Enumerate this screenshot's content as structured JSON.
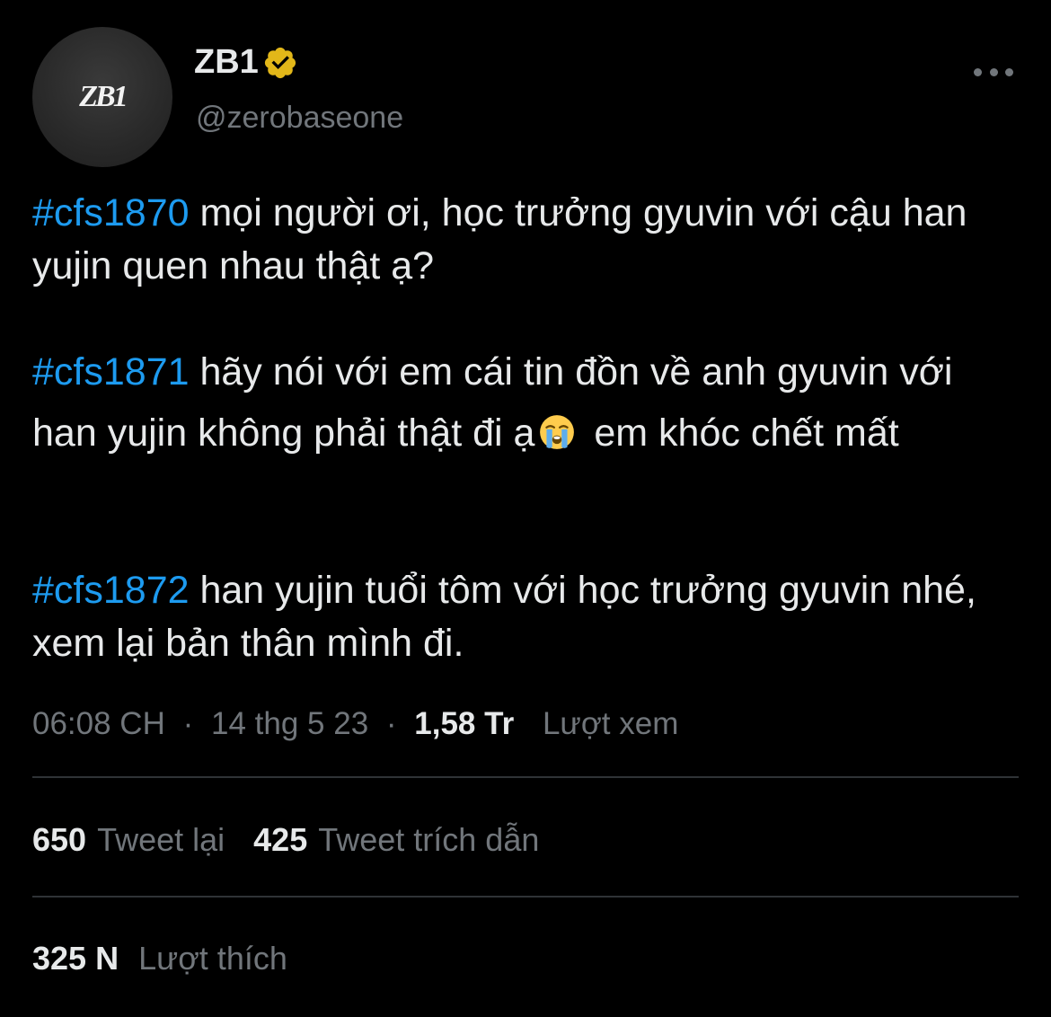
{
  "author": {
    "avatar_logo": "ZB1",
    "display_name": "ZB1",
    "handle": "@zerobaseone",
    "verified_badge_color": "#e2b719"
  },
  "body": {
    "p1_hashtag": "#cfs1870",
    "p1_text": " mọi người ơi, học trưởng gyuvin với cậu han yujin quen nhau thật ạ?",
    "p2_hashtag": "#cfs1871",
    "p2_text_before_emoji": " hãy nói với em cái tin đồn về anh gyuvin với han yujin không phải thật đi ạ",
    "p2_emoji": "loudly-crying-face-icon",
    "p2_text_after_emoji": " em khóc chết mất",
    "p3_hashtag": "#cfs1872",
    "p3_text": " han yujin tuổi tôm với học trưởng gyuvin nhé, xem lại bản thân mình đi."
  },
  "meta": {
    "time": "06:08 CH",
    "separator": "·",
    "date": "14 thg 5 23",
    "views_count": "1,58 Tr",
    "views_label": "Lượt xem"
  },
  "stats": {
    "retweets_count": "650",
    "retweets_label": "Tweet lại",
    "quotes_count": "425",
    "quotes_label": "Tweet trích dẫn",
    "likes_count": "325 N",
    "likes_label": "Lượt thích"
  },
  "colors": {
    "background": "#000000",
    "text": "#e7e9ea",
    "secondary": "#71767b",
    "link": "#1d9bf0",
    "divider": "#2f3336"
  }
}
